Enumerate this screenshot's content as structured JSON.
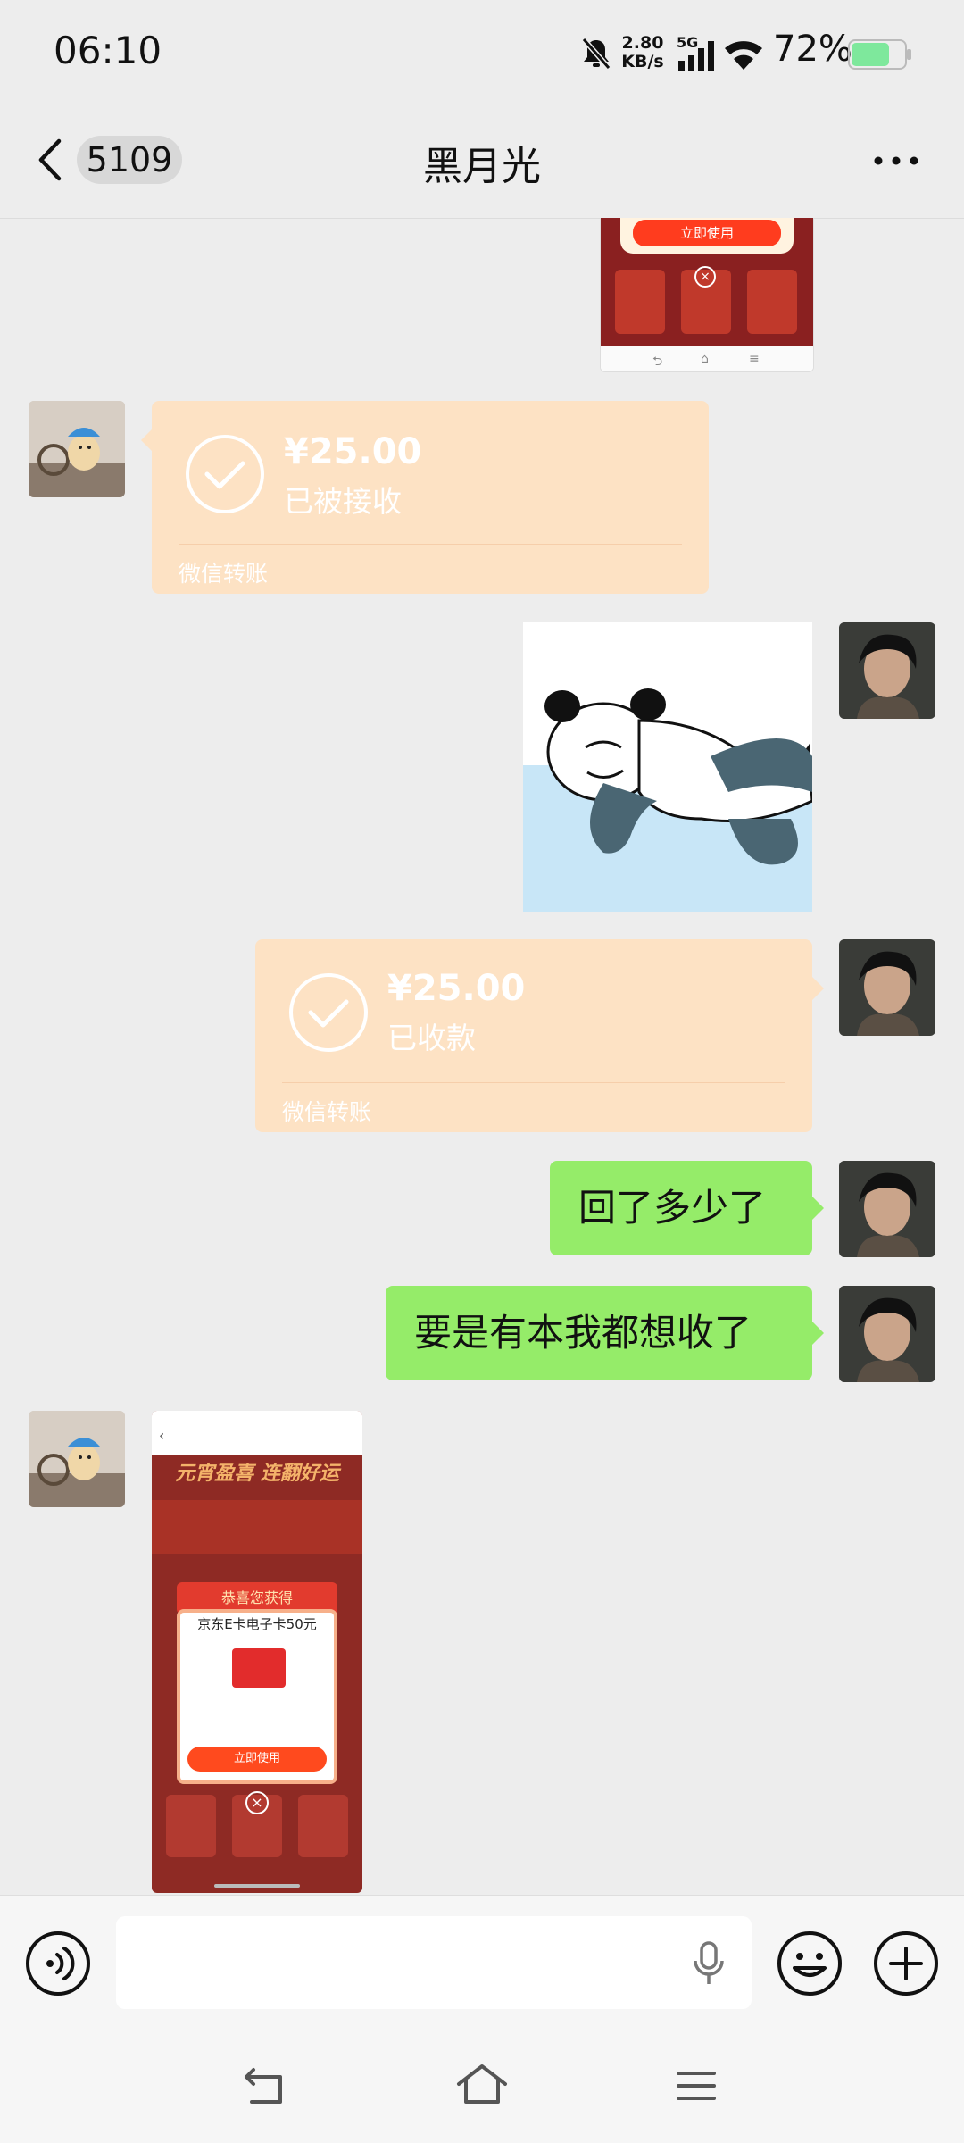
{
  "status_bar": {
    "time": "06:10",
    "net_speed_value": "2.80",
    "net_speed_unit": "KB/s",
    "network_type": "5G",
    "battery_percent": "72%",
    "battery_level": 0.72,
    "icons": [
      "mute-bell-icon",
      "signal-icon",
      "wifi-icon",
      "battery-icon"
    ]
  },
  "header": {
    "back_icon": "chevron-left-icon",
    "unread_count": "5109",
    "title": "黑月光",
    "more_icon": "more-dots-icon"
  },
  "messages": [
    {
      "side": "right",
      "type": "image",
      "content": "screenshot-thumbnail-partial",
      "button_text": "立即使用"
    },
    {
      "side": "left",
      "type": "transfer",
      "amount": "¥25.00",
      "state": "已被接收",
      "footer": "微信转账"
    },
    {
      "side": "right",
      "type": "sticker",
      "content": "panda-meme-sticker"
    },
    {
      "side": "right",
      "type": "transfer",
      "amount": "¥25.00",
      "state": "已收款",
      "footer": "微信转账"
    },
    {
      "side": "right",
      "type": "text",
      "text": "回了多少了"
    },
    {
      "side": "right",
      "type": "text",
      "text": "要是有本我都想收了"
    },
    {
      "side": "left",
      "type": "image",
      "content": "screenshot-thumbnail",
      "banner": "元宵盈喜 连翻好运",
      "ribbon": "恭喜您获得",
      "prize": "京东E卡电子卡50元",
      "button_text": "立即使用"
    }
  ],
  "input_bar": {
    "voice_icon": "voice-mode-icon",
    "placeholder": "",
    "mic_icon": "mic-icon",
    "emoji_icon": "emoji-icon",
    "plus_icon": "plus-icon"
  },
  "system_nav": {
    "icons": [
      "back-nav-icon",
      "home-nav-icon",
      "menu-nav-icon"
    ]
  },
  "colors": {
    "background": "#ededed",
    "transfer_bubble": "#fde2c4",
    "text_bubble": "#95ec69"
  }
}
